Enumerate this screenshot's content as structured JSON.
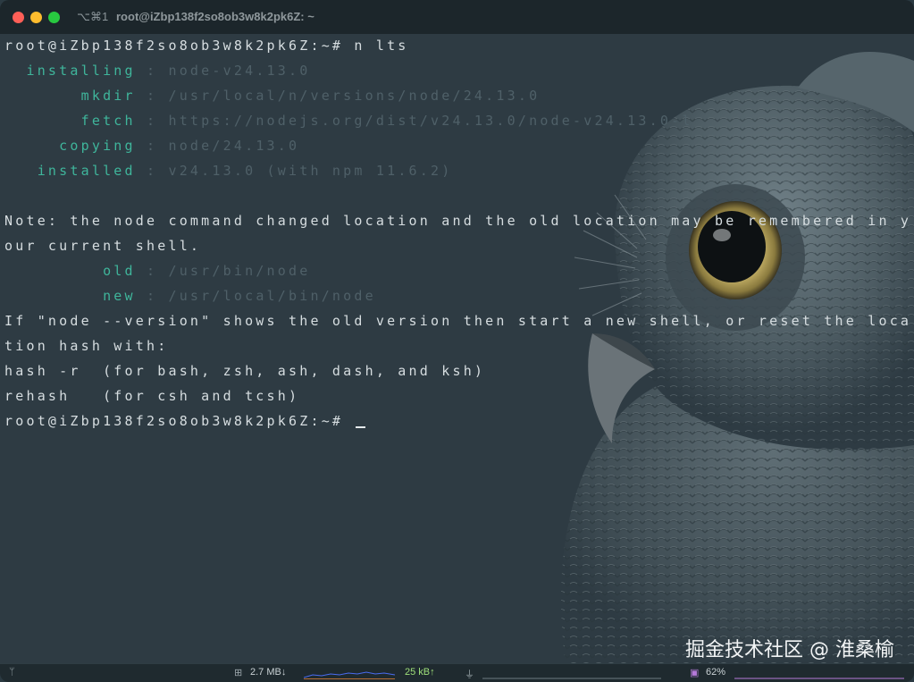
{
  "window": {
    "shortcut": "⌥⌘1",
    "title": "root@iZbp138f2so8ob3w8k2pk6Z: ~"
  },
  "terminal": {
    "lines": [
      {
        "parts": [
          {
            "text": "root@iZbp138f2so8ob3w8k2pk6Z:~# n lts",
            "style": "plain"
          }
        ]
      },
      {
        "parts": [
          {
            "text": "  installing",
            "style": "green"
          },
          {
            "text": " : node-v24.13.0",
            "style": "dim"
          }
        ]
      },
      {
        "parts": [
          {
            "text": "       mkdir",
            "style": "green"
          },
          {
            "text": " : /usr/local/n/versions/node/24.13.0",
            "style": "dim"
          }
        ]
      },
      {
        "parts": [
          {
            "text": "       fetch",
            "style": "green"
          },
          {
            "text": " : https://nodejs.org/dist/v24.13.0/node-v24.13.0-l",
            "style": "dim"
          }
        ]
      },
      {
        "parts": [
          {
            "text": "     copying",
            "style": "green"
          },
          {
            "text": " : node/24.13.0",
            "style": "dim"
          }
        ]
      },
      {
        "parts": [
          {
            "text": "   installed",
            "style": "green"
          },
          {
            "text": " : v24.13.0 (with npm 11.6.2)",
            "style": "dim"
          }
        ]
      },
      {
        "parts": []
      },
      {
        "parts": [
          {
            "text": "Note: the node command changed location and the old location may be remembered in y",
            "style": "plain"
          }
        ]
      },
      {
        "parts": [
          {
            "text": "our current shell.",
            "style": "plain"
          }
        ]
      },
      {
        "parts": [
          {
            "text": "         old",
            "style": "green"
          },
          {
            "text": " : /usr/bin/node",
            "style": "dim"
          }
        ]
      },
      {
        "parts": [
          {
            "text": "         new",
            "style": "green"
          },
          {
            "text": " : /usr/local/bin/node",
            "style": "dim"
          }
        ]
      },
      {
        "parts": [
          {
            "text": "If \"node --version\" shows the old version then start a new shell, or reset the loca",
            "style": "plain"
          }
        ]
      },
      {
        "parts": [
          {
            "text": "tion hash with:",
            "style": "plain"
          }
        ]
      },
      {
        "parts": [
          {
            "text": "hash -r  (for bash, zsh, ash, dash, and ksh)",
            "style": "plain"
          }
        ]
      },
      {
        "parts": [
          {
            "text": "rehash   (for csh and tcsh)",
            "style": "plain"
          }
        ]
      },
      {
        "parts": [
          {
            "text": "root@iZbp138f2so8ob3w8k2pk6Z:~# ",
            "style": "plain"
          }
        ],
        "cursor": true
      }
    ]
  },
  "statusbar": {
    "git_icon": "branch-icon",
    "network_icon": "network-icon",
    "download": "2.7 MB↓",
    "upload": "25 kB↑",
    "power_icon": "plug-icon",
    "cpu_icon": "cpu-chip-icon",
    "cpu": "62%",
    "colors": {
      "download": "#4a6cf0",
      "upload": "#e8833a",
      "cpu": "#b57ad9",
      "upload_text": "#9fe07a"
    }
  },
  "watermark": "掘金技术社区 @ 淮桑榆"
}
